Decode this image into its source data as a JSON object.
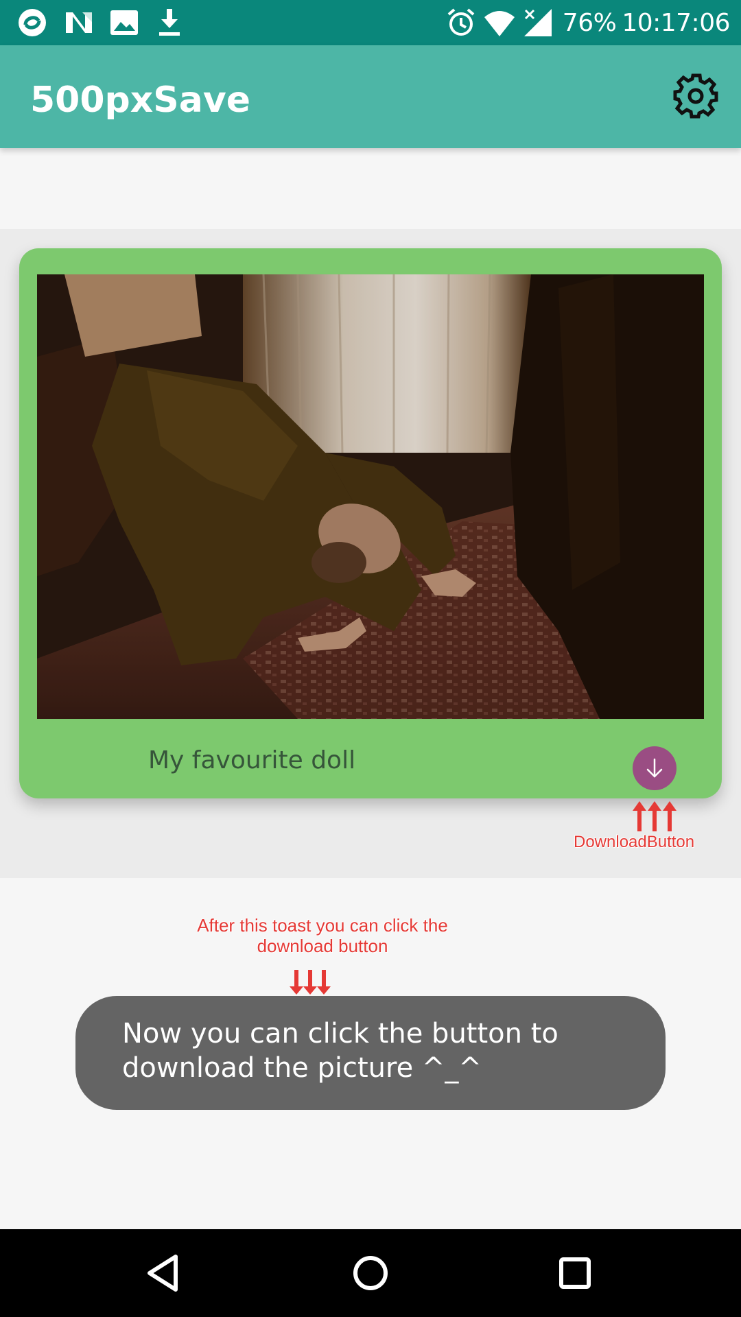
{
  "status_bar": {
    "left_icons": [
      "sync-icon",
      "n-notification-icon",
      "image-notification-icon",
      "download-notification-icon"
    ],
    "right_icons": [
      "alarm-icon",
      "wifi-icon",
      "cellular-no-signal-icon"
    ],
    "battery": "76%",
    "time": "10:17:06"
  },
  "app_bar": {
    "title": "500pxSave",
    "settings_icon": "gear-icon"
  },
  "card": {
    "caption": "My favourite doll",
    "download_icon": "arrow-down-icon"
  },
  "annotations": {
    "download_label": "DownloadButton",
    "toast_label": "After this toast you can click the download button"
  },
  "toast": {
    "message": "Now you can click the button to download the picture ^_^"
  },
  "nav_bar": {
    "icons": [
      "back-icon",
      "home-icon",
      "recents-icon"
    ]
  },
  "colors": {
    "status_bar": "#0a877b",
    "app_bar": "#4db6a6",
    "card": "#7dc96e",
    "download_button": "#9a4d83",
    "toast": "#646464",
    "annotation": "#e53935"
  }
}
